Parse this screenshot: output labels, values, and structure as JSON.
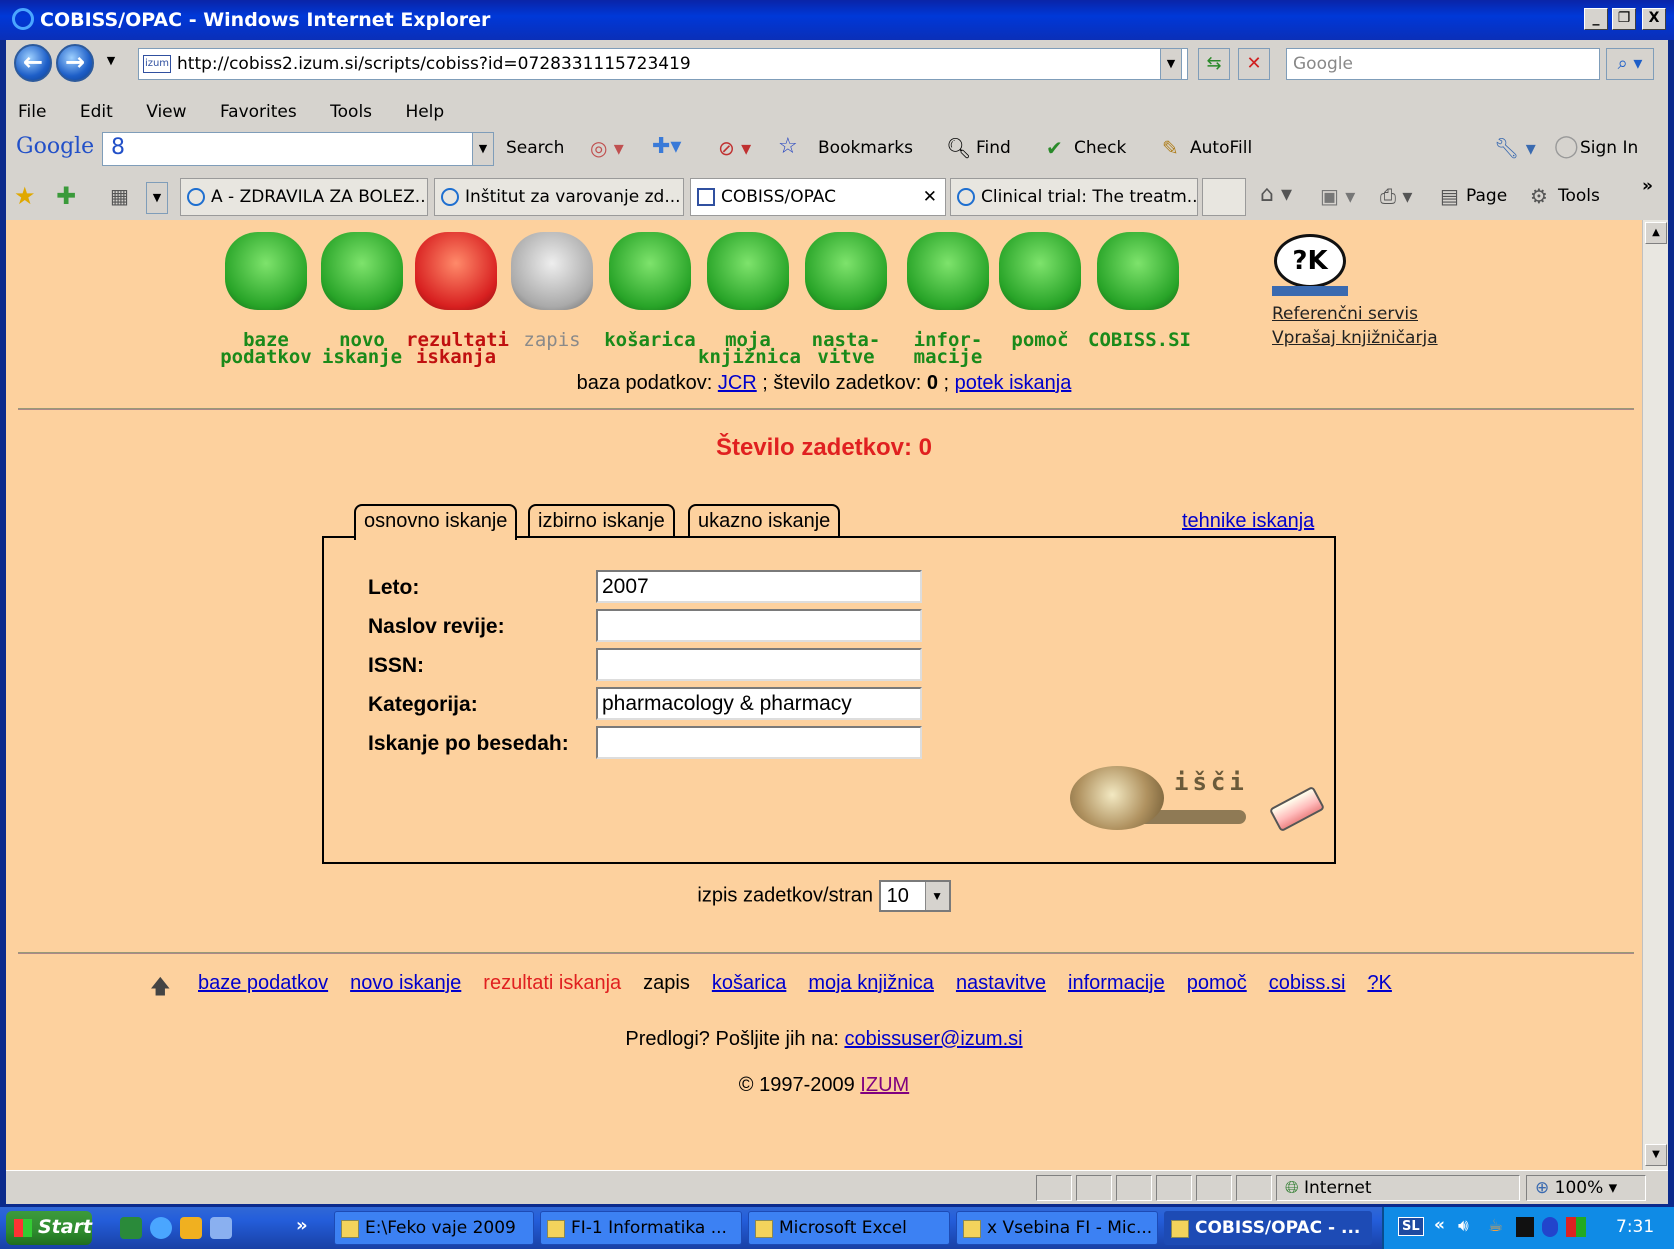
{
  "window": {
    "title": "COBISS/OPAC - Windows Internet Explorer",
    "min": "_",
    "max": "❐",
    "close": "X"
  },
  "toolbar": {
    "address": "http://cobiss2.izum.si/scripts/cobiss?id=0728331115723419",
    "address_icon": "izum",
    "search_placeholder": "Google"
  },
  "menu": [
    "File",
    "Edit",
    "View",
    "Favorites",
    "Tools",
    "Help"
  ],
  "google_bar": {
    "logo": "Google",
    "box_text": "8",
    "search": "Search",
    "bookmarks": "Bookmarks",
    "find": "Find",
    "check": "Check",
    "autofill": "AutoFill",
    "sign_in": "Sign In"
  },
  "tabs": [
    {
      "label": "A - ZDRAVILA ZA BOLEZ..."
    },
    {
      "label": "Inštitut za varovanje zd..."
    },
    {
      "label": "COBISS/OPAC"
    },
    {
      "label": "Clinical trial: The treatm..."
    }
  ],
  "command_bar": {
    "page": "Page",
    "tools": "Tools"
  },
  "nav_icons": [
    {
      "label": "baze\npodatkov",
      "color": "green"
    },
    {
      "label": "novo\niskanje",
      "color": "green"
    },
    {
      "label": "rezultati\niskanja",
      "color": "red"
    },
    {
      "label": "zapis",
      "color": "grey"
    },
    {
      "label": "košarica",
      "color": "green"
    },
    {
      "label": "moja\nknjižnica",
      "color": "green"
    },
    {
      "label": "nasta-\nvitve",
      "color": "green"
    },
    {
      "label": "infor-\nmacije",
      "color": "green"
    },
    {
      "label": "pomoč",
      "color": "green"
    },
    {
      "label": "COBISS.SI",
      "color": "green"
    }
  ],
  "ref_service": {
    "icon_text": "?K",
    "line1": "Referenčni servis",
    "line2": "Vprašaj knjižničarja"
  },
  "status_line": {
    "db_label": "baza podatkov:",
    "db_value": "JCR",
    "hits_label": "; število zadetkov:",
    "hits_value": "0",
    "sep": ";",
    "history": "potek iskanja"
  },
  "hits_heading": "Število zadetkov: 0",
  "search_tabs": [
    "osnovno iskanje",
    "izbirno iskanje",
    "ukazno iskanje"
  ],
  "techniques_link": "tehnike iskanja",
  "form": {
    "fields": [
      {
        "label": "Leto:",
        "value": "2007"
      },
      {
        "label": "Naslov revije:",
        "value": ""
      },
      {
        "label": "ISSN:",
        "value": ""
      },
      {
        "label": "Kategorija:",
        "value": "pharmacology & pharmacy"
      },
      {
        "label": "Iskanje po besedah:",
        "value": ""
      }
    ],
    "search_button": "išči"
  },
  "per_page": {
    "label": "izpis zadetkov/stran",
    "value": "10"
  },
  "footer_nav": [
    {
      "label": "baze podatkov",
      "type": "link"
    },
    {
      "label": "novo iskanje",
      "type": "link"
    },
    {
      "label": "rezultati iskanja",
      "type": "red"
    },
    {
      "label": "zapis",
      "type": "text"
    },
    {
      "label": "košarica",
      "type": "link"
    },
    {
      "label": "moja knjižnica",
      "type": "link"
    },
    {
      "label": "nastavitve",
      "type": "link"
    },
    {
      "label": "informacije",
      "type": "link"
    },
    {
      "label": "pomoč",
      "type": "link"
    },
    {
      "label": "cobiss.si",
      "type": "link"
    },
    {
      "label": "?K",
      "type": "link"
    }
  ],
  "footer": {
    "suggest": "Predlogi? Pošljite jih na:",
    "email": "cobissuser@izum.si",
    "copyright": "© 1997-2009",
    "izum": "IZUM"
  },
  "statusbar": {
    "zone": "Internet",
    "zoom": "100%"
  },
  "taskbar": {
    "start": "Start",
    "items": [
      {
        "label": "E:\\Feko vaje 2009",
        "active": false
      },
      {
        "label": "FI-1 Informatika ...",
        "active": false
      },
      {
        "label": "Microsoft Excel",
        "active": false
      },
      {
        "label": "x Vsebina FI - Mic...",
        "active": false
      },
      {
        "label": "COBISS/OPAC - ...",
        "active": true
      }
    ],
    "lang": "SL",
    "clock": "7:31"
  }
}
